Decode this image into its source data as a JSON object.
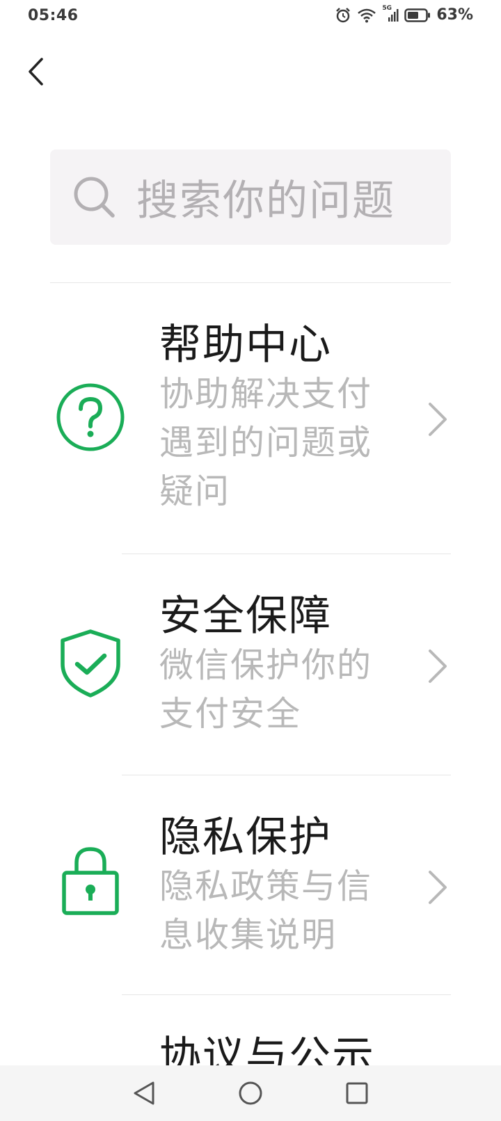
{
  "status_bar": {
    "time": "05:46",
    "network": "5G",
    "battery": "63%",
    "battery_level": 0.63
  },
  "search": {
    "placeholder": "搜索你的问题"
  },
  "items": [
    {
      "title": "帮助中心",
      "desc": "协助解决支付遇到的问题或疑问",
      "icon": "help-icon"
    },
    {
      "title": "安全保障",
      "desc": "微信保护你的支付安全",
      "icon": "shield-check-icon"
    },
    {
      "title": "隐私保护",
      "desc": "隐私政策与信息收集说明",
      "icon": "lock-icon"
    },
    {
      "title": "协议与公示",
      "desc": "",
      "icon": ""
    }
  ],
  "colors": {
    "accent": "#1aad57",
    "title": "#1a1a1a",
    "subtitle": "#b8b8b8",
    "search_bg": "#f5f3f5"
  }
}
